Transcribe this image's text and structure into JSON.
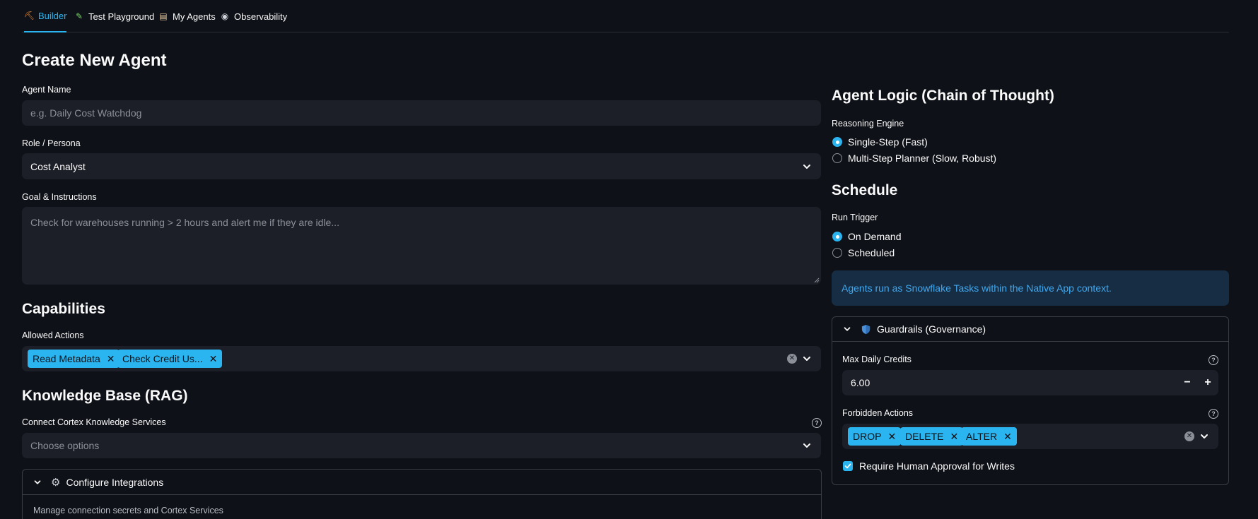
{
  "tabs": [
    {
      "label": "Builder",
      "icon": "builder-icon"
    },
    {
      "label": "Test Playground",
      "icon": "pencil-icon"
    },
    {
      "label": "My Agents",
      "icon": "clipboard-icon"
    },
    {
      "label": "Observability",
      "icon": "eye-icon"
    }
  ],
  "page_title": "Create New Agent",
  "agent_name": {
    "label": "Agent Name",
    "placeholder": "e.g. Daily Cost Watchdog",
    "value": ""
  },
  "role": {
    "label": "Role / Persona",
    "value": "Cost Analyst"
  },
  "goal": {
    "label": "Goal & Instructions",
    "placeholder": "Check for warehouses running > 2 hours and alert me if they are idle..."
  },
  "capabilities": {
    "heading": "Capabilities",
    "label": "Allowed Actions",
    "chips": [
      "Read Metadata",
      "Check Credit Us..."
    ]
  },
  "knowledge": {
    "heading": "Knowledge Base (RAG)",
    "label": "Connect Cortex Knowledge Services",
    "placeholder": "Choose options"
  },
  "integrations": {
    "title": "Configure Integrations",
    "icon": "gear-icon",
    "description": "Manage connection secrets and Cortex Services"
  },
  "logic": {
    "heading": "Agent Logic (Chain of Thought)",
    "label": "Reasoning Engine",
    "options": [
      "Single-Step (Fast)",
      "Multi-Step Planner (Slow, Robust)"
    ],
    "selected": 0
  },
  "schedule": {
    "heading": "Schedule",
    "label": "Run Trigger",
    "options": [
      "On Demand",
      "Scheduled"
    ],
    "selected": 0
  },
  "info_message": "Agents run as Snowflake Tasks within the Native App context.",
  "guardrails": {
    "title": "Guardrails (Governance)",
    "icon": "shield-icon",
    "max_credits_label": "Max Daily Credits",
    "max_credits_value": "6.00",
    "forbidden_label": "Forbidden Actions",
    "forbidden_chips": [
      "DROP",
      "DELETE",
      "ALTER"
    ],
    "approval_label": "Require Human Approval for Writes",
    "approval_checked": true
  },
  "colors": {
    "accent": "#2bb5f0",
    "background": "#0e1117",
    "field": "#1c1f27",
    "info_bg": "#172d43",
    "info_text": "#3fa8f0"
  }
}
